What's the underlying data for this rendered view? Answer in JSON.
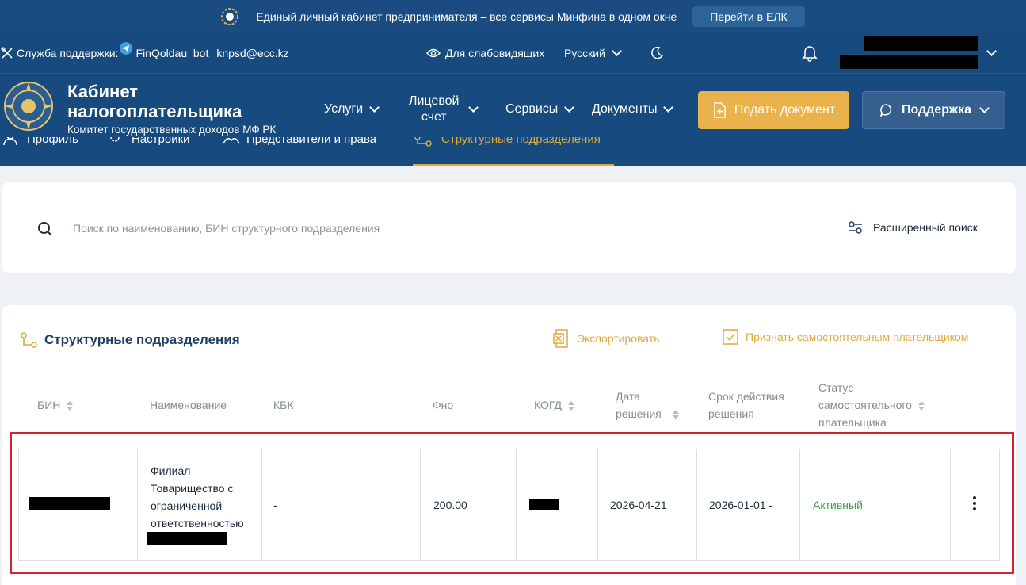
{
  "promo": {
    "text": "Единый личный кабинет предпринимателя – все сервисы Минфина в одном окне",
    "button": "Перейти в ЕЛК"
  },
  "topbar": {
    "support_label": "Служба поддержки:",
    "bot": "FinQoldau_bot",
    "email": "knpsd@ecc.kz",
    "low_vision": "Для слабовидящих",
    "language": "Русский"
  },
  "header": {
    "title_line1": "Кабинет",
    "title_line2": "налогоплательщика",
    "subtitle": "Комитет государственных доходов МФ РК",
    "menu": {
      "services": "Услуги",
      "account_line1": "Лицевой",
      "account_line2": "счет",
      "tools": "Сервисы",
      "documents": "Документы"
    },
    "submit_button": "Подать документ",
    "support_button": "Поддержка"
  },
  "subtabs": {
    "profile": "Профиль",
    "settings": "Настройки",
    "representatives": "Представители и права",
    "divisions": "Структурные подразделения"
  },
  "search": {
    "placeholder": "Поиск по наименованию, БИН структурного подразделения",
    "advanced": "Расширенный поиск"
  },
  "section": {
    "title": "Структурные подразделения",
    "export": "Экспортировать",
    "recognize": "Признать самостоятельным плательщиком"
  },
  "table": {
    "headers": {
      "bin": "БИН",
      "name": "Наименование",
      "kbk": "КБК",
      "fno": "Фно",
      "kogd": "КОГД",
      "decision_date_1": "Дата",
      "decision_date_2": "решения",
      "validity_1": "Срок действия",
      "validity_2": "решения",
      "status_1": "Статус",
      "status_2": "самостоятельного",
      "status_3": "плательщика"
    },
    "row": {
      "name_1": "Филиал",
      "name_2": "Товарищество с",
      "name_3": "ограниченной",
      "name_4": "ответственностью",
      "kbk": "-",
      "fno": "200.00",
      "decision_date": "2026-04-21",
      "validity": "2026-01-01 -",
      "status": "Активный",
      "status_color": "#3aa54a"
    }
  }
}
